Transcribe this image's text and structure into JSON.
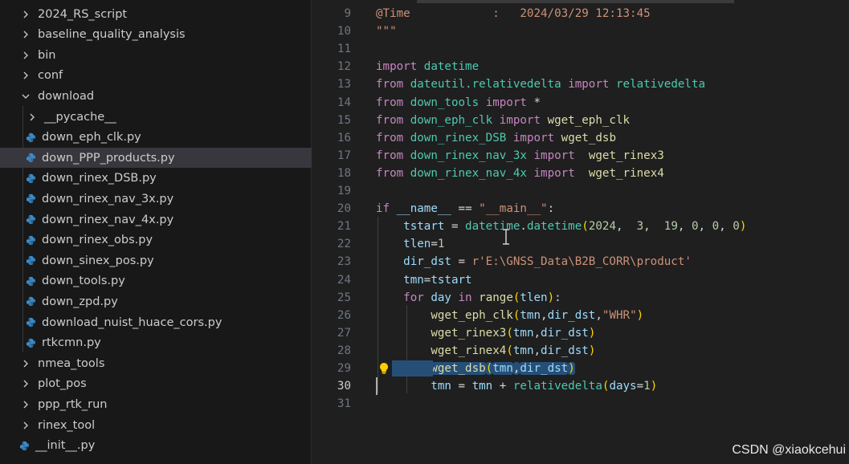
{
  "explorer": {
    "items": [
      {
        "label": "2024_RS_script",
        "kind": "folder",
        "expanded": false,
        "level": 0
      },
      {
        "label": "baseline_quality_analysis",
        "kind": "folder",
        "expanded": false,
        "level": 0
      },
      {
        "label": "bin",
        "kind": "folder",
        "expanded": false,
        "level": 0
      },
      {
        "label": "conf",
        "kind": "folder",
        "expanded": false,
        "level": 0
      },
      {
        "label": "download",
        "kind": "folder",
        "expanded": true,
        "level": 0
      },
      {
        "label": "__pycache__",
        "kind": "folder",
        "expanded": false,
        "level": 1
      },
      {
        "label": "down_eph_clk.py",
        "kind": "file",
        "level": 1
      },
      {
        "label": "down_PPP_products.py",
        "kind": "file",
        "level": 1,
        "selected": true
      },
      {
        "label": "down_rinex_DSB.py",
        "kind": "file",
        "level": 1
      },
      {
        "label": "down_rinex_nav_3x.py",
        "kind": "file",
        "level": 1
      },
      {
        "label": "down_rinex_nav_4x.py",
        "kind": "file",
        "level": 1
      },
      {
        "label": "down_rinex_obs.py",
        "kind": "file",
        "level": 1
      },
      {
        "label": "down_sinex_pos.py",
        "kind": "file",
        "level": 1
      },
      {
        "label": "down_tools.py",
        "kind": "file",
        "level": 1
      },
      {
        "label": "down_zpd.py",
        "kind": "file",
        "level": 1
      },
      {
        "label": "download_nuist_huace_cors.py",
        "kind": "file",
        "level": 1
      },
      {
        "label": "rtkcmn.py",
        "kind": "file",
        "level": 1
      },
      {
        "label": "nmea_tools",
        "kind": "folder",
        "expanded": false,
        "level": 0
      },
      {
        "label": "plot_pos",
        "kind": "folder",
        "expanded": false,
        "level": 0
      },
      {
        "label": "ppp_rtk_run",
        "kind": "folder",
        "expanded": false,
        "level": 0
      },
      {
        "label": "rinex_tool",
        "kind": "folder",
        "expanded": false,
        "level": 0
      },
      {
        "label": "__init__.py",
        "kind": "file",
        "level": 0
      }
    ]
  },
  "editor": {
    "active_line": "30",
    "lines": [
      {
        "num": "9",
        "tokens": [
          [
            "@Time",
            "s"
          ],
          [
            "            :   ",
            "s"
          ],
          [
            "2024/03/29 12:13:45",
            "s"
          ]
        ]
      },
      {
        "num": "10",
        "tokens": [
          [
            "\"\"\"",
            "s"
          ]
        ]
      },
      {
        "num": "11",
        "tokens": []
      },
      {
        "num": "12",
        "tokens": [
          [
            "import",
            "k"
          ],
          [
            " ",
            "o"
          ],
          [
            "datetime",
            "m"
          ]
        ]
      },
      {
        "num": "13",
        "tokens": [
          [
            "from",
            "k"
          ],
          [
            " ",
            "o"
          ],
          [
            "dateutil.relativedelta",
            "m"
          ],
          [
            " ",
            "o"
          ],
          [
            "import",
            "k"
          ],
          [
            " ",
            "o"
          ],
          [
            "relativedelta",
            "m"
          ]
        ]
      },
      {
        "num": "14",
        "tokens": [
          [
            "from",
            "k"
          ],
          [
            " ",
            "o"
          ],
          [
            "down_tools",
            "m"
          ],
          [
            " ",
            "o"
          ],
          [
            "import",
            "k"
          ],
          [
            " *",
            "o"
          ]
        ]
      },
      {
        "num": "15",
        "tokens": [
          [
            "from",
            "k"
          ],
          [
            " ",
            "o"
          ],
          [
            "down_eph_clk",
            "m"
          ],
          [
            " ",
            "o"
          ],
          [
            "import",
            "k"
          ],
          [
            " ",
            "o"
          ],
          [
            "wget_eph_clk",
            "f"
          ]
        ]
      },
      {
        "num": "16",
        "tokens": [
          [
            "from",
            "k"
          ],
          [
            " ",
            "o"
          ],
          [
            "down_rinex_DSB",
            "m"
          ],
          [
            " ",
            "o"
          ],
          [
            "import",
            "k"
          ],
          [
            " ",
            "o"
          ],
          [
            "wget_dsb",
            "f"
          ]
        ]
      },
      {
        "num": "17",
        "tokens": [
          [
            "from",
            "k"
          ],
          [
            " ",
            "o"
          ],
          [
            "down_rinex_nav_3x",
            "m"
          ],
          [
            " ",
            "o"
          ],
          [
            "import",
            "k"
          ],
          [
            "  ",
            "o"
          ],
          [
            "wget_rinex3",
            "f"
          ]
        ]
      },
      {
        "num": "18",
        "tokens": [
          [
            "from",
            "k"
          ],
          [
            " ",
            "o"
          ],
          [
            "down_rinex_nav_4x",
            "m"
          ],
          [
            " ",
            "o"
          ],
          [
            "import",
            "k"
          ],
          [
            "  ",
            "o"
          ],
          [
            "wget_rinex4",
            "f"
          ]
        ]
      },
      {
        "num": "19",
        "tokens": []
      },
      {
        "num": "20",
        "tokens": [
          [
            "if",
            "k"
          ],
          [
            " ",
            "o"
          ],
          [
            "__name__",
            "v"
          ],
          [
            " == ",
            "o"
          ],
          [
            "\"__main__\"",
            "s"
          ],
          [
            ":",
            "o"
          ]
        ]
      },
      {
        "num": "21",
        "tokens": [
          [
            "    ",
            "o"
          ],
          [
            "tstart",
            "v"
          ],
          [
            " = ",
            "o"
          ],
          [
            "datetime",
            "m"
          ],
          [
            ".",
            "o"
          ],
          [
            "datetime",
            "m"
          ],
          [
            "(",
            "b"
          ],
          [
            "2024",
            "n"
          ],
          [
            ",  ",
            "o"
          ],
          [
            "3",
            "n"
          ],
          [
            ",  ",
            "o"
          ],
          [
            "19",
            "n"
          ],
          [
            ", ",
            "o"
          ],
          [
            "0",
            "n"
          ],
          [
            ", ",
            "o"
          ],
          [
            "0",
            "n"
          ],
          [
            ", ",
            "o"
          ],
          [
            "0",
            "n"
          ],
          [
            ")",
            "b"
          ]
        ]
      },
      {
        "num": "22",
        "tokens": [
          [
            "    ",
            "o"
          ],
          [
            "tlen",
            "v"
          ],
          [
            "=",
            "o"
          ],
          [
            "1",
            "n"
          ]
        ]
      },
      {
        "num": "23",
        "tokens": [
          [
            "    ",
            "o"
          ],
          [
            "dir_dst",
            "v"
          ],
          [
            " = ",
            "o"
          ],
          [
            "r'E:\\GNSS_Data\\B2B_CORR\\product'",
            "s"
          ]
        ]
      },
      {
        "num": "24",
        "tokens": [
          [
            "    ",
            "o"
          ],
          [
            "tmn",
            "v"
          ],
          [
            "=",
            "o"
          ],
          [
            "tstart",
            "v"
          ]
        ]
      },
      {
        "num": "25",
        "tokens": [
          [
            "    ",
            "o"
          ],
          [
            "for",
            "k"
          ],
          [
            " ",
            "o"
          ],
          [
            "day",
            "v"
          ],
          [
            " ",
            "o"
          ],
          [
            "in",
            "k"
          ],
          [
            " ",
            "o"
          ],
          [
            "range",
            "f"
          ],
          [
            "(",
            "b"
          ],
          [
            "tlen",
            "v"
          ],
          [
            ")",
            "b"
          ],
          [
            ":",
            "o"
          ]
        ]
      },
      {
        "num": "26",
        "tokens": [
          [
            "        ",
            "o"
          ],
          [
            "wget_eph_clk",
            "f"
          ],
          [
            "(",
            "b"
          ],
          [
            "tmn",
            "v"
          ],
          [
            ",",
            "o"
          ],
          [
            "dir_dst",
            "v"
          ],
          [
            ",",
            "o"
          ],
          [
            "\"WHR\"",
            "s"
          ],
          [
            ")",
            "b"
          ]
        ]
      },
      {
        "num": "27",
        "tokens": [
          [
            "        ",
            "o"
          ],
          [
            "wget_rinex3",
            "f"
          ],
          [
            "(",
            "b"
          ],
          [
            "tmn",
            "v"
          ],
          [
            ",",
            "o"
          ],
          [
            "dir_dst",
            "v"
          ],
          [
            ")",
            "b"
          ]
        ]
      },
      {
        "num": "28",
        "tokens": [
          [
            "        ",
            "o"
          ],
          [
            "wget_rinex4",
            "f"
          ],
          [
            "(",
            "b"
          ],
          [
            "tmn",
            "v"
          ],
          [
            ",",
            "o"
          ],
          [
            "dir_dst",
            "v"
          ],
          [
            ")",
            "b"
          ]
        ]
      },
      {
        "num": "29",
        "tokens": [
          [
            "        ",
            "o"
          ],
          [
            "wget_dsb",
            "f"
          ],
          [
            "(",
            "b"
          ],
          [
            "tmn",
            "v"
          ],
          [
            ",",
            "o"
          ],
          [
            "dir_dst",
            "v"
          ],
          [
            ")",
            "b"
          ]
        ],
        "selected": true
      },
      {
        "num": "30",
        "tokens": [
          [
            "        ",
            "o"
          ],
          [
            "tmn",
            "v"
          ],
          [
            " = ",
            "o"
          ],
          [
            "tmn",
            "v"
          ],
          [
            " + ",
            "o"
          ],
          [
            "relativedelta",
            "m"
          ],
          [
            "(",
            "b"
          ],
          [
            "days",
            "v"
          ],
          [
            "=",
            "o"
          ],
          [
            "1",
            "n"
          ],
          [
            ")",
            "b"
          ]
        ]
      },
      {
        "num": "31",
        "tokens": []
      }
    ]
  },
  "watermark": "CSDN @xiaokcehui",
  "colors": {
    "keyword": "#c586c0",
    "module": "#4ec9b0",
    "function": "#dcdcaa",
    "variable": "#9cdcfe",
    "string": "#ce9178",
    "number": "#b5cea8",
    "selection": "#264f78",
    "python_icon": "#3c8fd0"
  },
  "icons": {
    "folder_collapsed": "chevron-right-icon",
    "folder_expanded": "chevron-down-icon",
    "python_file": "python-file-icon",
    "lightbulb": "lightbulb-icon"
  }
}
